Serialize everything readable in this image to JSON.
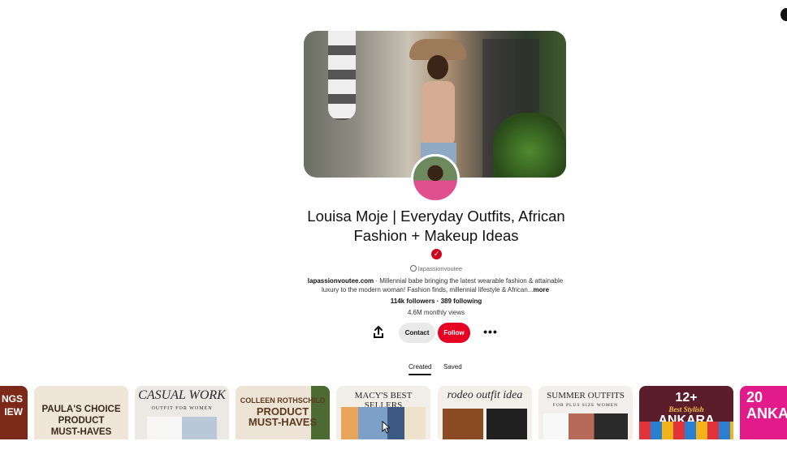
{
  "profile": {
    "name": "Louisa Moje | Everyday Outfits, African Fashion + Makeup Ideas",
    "handle": "lapassionvoutee",
    "website": "lapassionvoutee.com",
    "bio": " · Millennial babe bringing the latest wearable fashion & attainable luxury to the modern woman! Fashion finds, millennial lifestyle & African...",
    "bio_more": "more",
    "followers": "114k followers",
    "separator": " · ",
    "following": "389 following",
    "monthly_views": "4.6M monthly views",
    "verified_color": "#d0021b"
  },
  "actions": {
    "contact_label": "Contact",
    "follow_label": "Follow",
    "share_icon": "share-icon",
    "more_icon": "more-options-icon",
    "follow_color": "#e60023"
  },
  "tabs": [
    {
      "label": "Created",
      "active": true
    },
    {
      "label": "Saved",
      "active": false
    }
  ],
  "pins": [
    {
      "lines": [
        "NGS",
        "IEW"
      ]
    },
    {
      "lines": [
        "PAULA'S CHOICE",
        "PRODUCT",
        "MUST-HAVES"
      ]
    },
    {
      "lines": [
        "CASUAL WORK",
        "OUTFIT FOR WOMEN"
      ]
    },
    {
      "lines": [
        "COLLEEN ROTHSCHILD",
        "PRODUCT",
        "MUST-HAVES"
      ]
    },
    {
      "lines": [
        "MACY'S BEST SELLERS"
      ]
    },
    {
      "lines": [
        "rodeo outfit idea"
      ]
    },
    {
      "lines": [
        "SUMMER OUTFITS",
        "FOR PLUS SIZE WOMEN"
      ]
    },
    {
      "lines": [
        "12+",
        "Best Stylish",
        "ANKARA TOPS"
      ]
    },
    {
      "lines": [
        "20",
        "ANKAR"
      ]
    }
  ]
}
